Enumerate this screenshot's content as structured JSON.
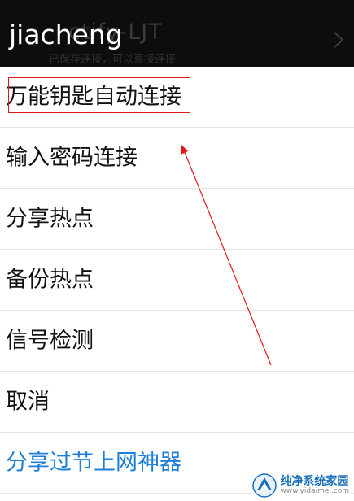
{
  "header": {
    "title": "jiacheng",
    "background_ssid": "ctify-LJT",
    "background_subtitle": "已保存连接，可以直接连接",
    "chevron_icon": "chevron-right-icon"
  },
  "menu": {
    "items": [
      {
        "label": "万能钥匙自动连接"
      },
      {
        "label": "输入密码连接"
      },
      {
        "label": "分享热点"
      },
      {
        "label": "备份热点"
      },
      {
        "label": "信号检测"
      },
      {
        "label": "取消"
      },
      {
        "label": "分享过节上网神器"
      }
    ]
  },
  "colors": {
    "header_bg": "#0d0d0d",
    "title": "#ffffff",
    "item_text": "#111111",
    "highlight_text": "#1f7fd6",
    "annotation": "#e01818"
  },
  "watermark": {
    "name": "纯净系统家园",
    "url": "www.yidaimei.com"
  }
}
